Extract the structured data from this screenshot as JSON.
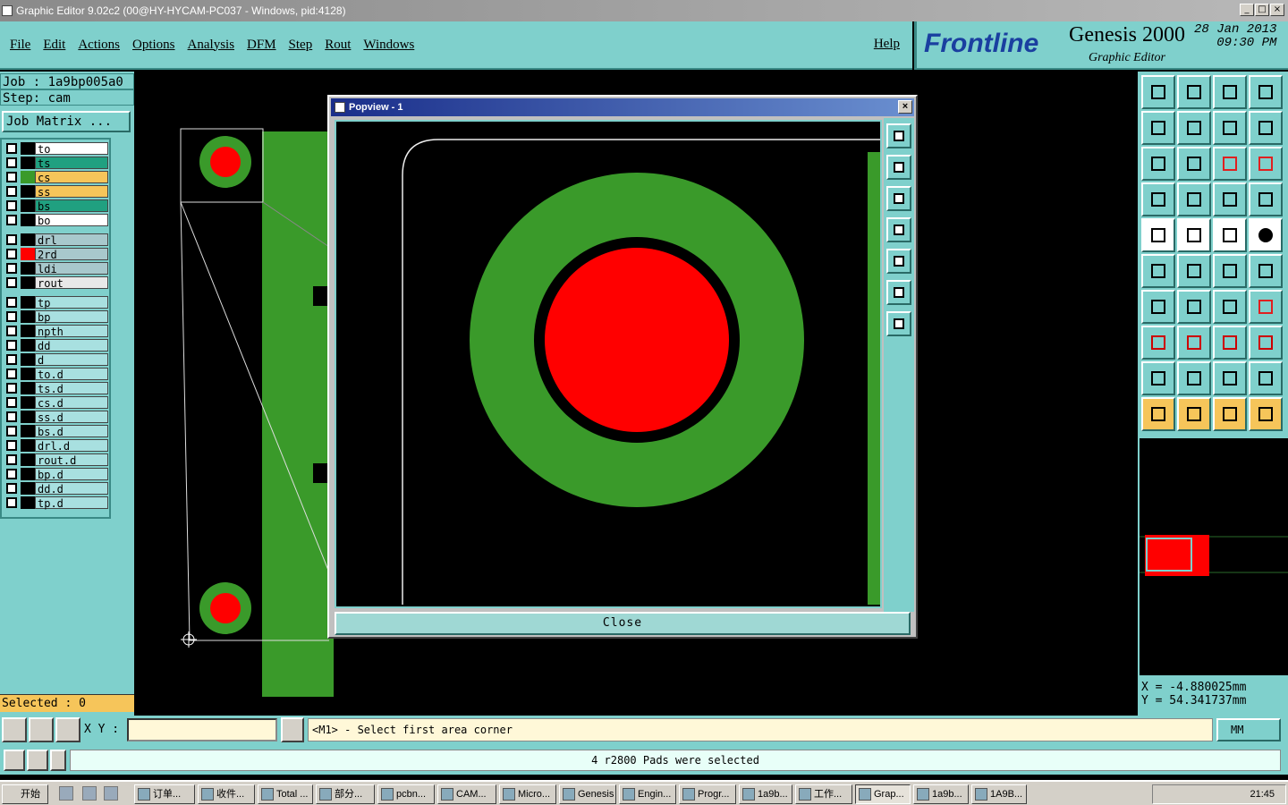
{
  "window": {
    "title": "Graphic Editor 9.02c2 (00@HY-HYCAM-PC037 - Windows, pid:4128)",
    "min": "_",
    "max": "□",
    "close": "×"
  },
  "menu": {
    "items": [
      "File",
      "Edit",
      "Actions",
      "Options",
      "Analysis",
      "DFM",
      "Step",
      "Rout",
      "Windows"
    ],
    "help": "Help"
  },
  "brand": {
    "logo": "Frontline",
    "product": "Genesis 2000",
    "subtitle": "Graphic Editor",
    "date": "28 Jan 2013",
    "time": "09:30 PM"
  },
  "job": {
    "job_line": "Job : 1a9bp005a0",
    "step_line": "Step: cam",
    "matrix_button": "Job Matrix ..."
  },
  "layers": [
    {
      "name": "to",
      "color": "#ffffff",
      "swatch": "#000000"
    },
    {
      "name": "ts",
      "color": "#20a080",
      "swatch": "#000000"
    },
    {
      "name": "cs",
      "color": "#f6c55a",
      "swatch": "#3a9a2a"
    },
    {
      "name": "ss",
      "color": "#f6c55a",
      "swatch": "#000000"
    },
    {
      "name": "bs",
      "color": "#20a080",
      "swatch": "#000000"
    },
    {
      "name": "bo",
      "color": "#ffffff",
      "swatch": "#000000"
    },
    {
      "name": "drl",
      "color": "#a8c8cc",
      "swatch": "#000000"
    },
    {
      "name": "2rd",
      "color": "#a8c8cc",
      "swatch": "#ff0000"
    },
    {
      "name": "ldi",
      "color": "#a8c8cc",
      "swatch": "#000000"
    },
    {
      "name": "rout",
      "color": "#e8e8e8",
      "swatch": "#000000"
    },
    {
      "name": "tp",
      "color": "#a8e0e0",
      "swatch": "#000000"
    },
    {
      "name": "bp",
      "color": "#a8e0e0",
      "swatch": "#000000"
    },
    {
      "name": "npth",
      "color": "#a8e0e0",
      "swatch": "#000000"
    },
    {
      "name": "dd",
      "color": "#a8e0e0",
      "swatch": "#000000"
    },
    {
      "name": "d",
      "color": "#a8e0e0",
      "swatch": "#000000"
    },
    {
      "name": "to.d",
      "color": "#a8e0e0",
      "swatch": "#000000"
    },
    {
      "name": "ts.d",
      "color": "#a8e0e0",
      "swatch": "#000000"
    },
    {
      "name": "cs.d",
      "color": "#a8e0e0",
      "swatch": "#000000"
    },
    {
      "name": "ss.d",
      "color": "#a8e0e0",
      "swatch": "#000000"
    },
    {
      "name": "bs.d",
      "color": "#a8e0e0",
      "swatch": "#000000"
    },
    {
      "name": "drl.d",
      "color": "#a8e0e0",
      "swatch": "#000000"
    },
    {
      "name": "rout.d",
      "color": "#a8e0e0",
      "swatch": "#000000"
    },
    {
      "name": "bp.d",
      "color": "#a8e0e0",
      "swatch": "#000000"
    },
    {
      "name": "dd.d",
      "color": "#a8e0e0",
      "swatch": "#000000"
    },
    {
      "name": "tp.d",
      "color": "#a8e0e0",
      "swatch": "#000000"
    }
  ],
  "selected_count": "Selected : 0",
  "popview": {
    "title": "Popview - 1",
    "close_label": "Close"
  },
  "coords": {
    "x": "X = -4.880025mm",
    "y": "Y = 54.341737mm"
  },
  "command": {
    "xy_label": "X Y :",
    "xy_value": "",
    "prompt": "<M1> - Select first area corner",
    "unit": "MM"
  },
  "status_message": "4 r2800 Pads were selected",
  "taskbar": {
    "start": "开始",
    "tasks": [
      "订单...",
      "收件...",
      "Total ...",
      "部分...",
      "pcbn...",
      "CAM...",
      "Micro...",
      "Genesis",
      "Engin...",
      "Progr...",
      "1a9b...",
      "工作...",
      "Grap...",
      "1a9b...",
      "1A9B..."
    ],
    "clock": "21:45"
  },
  "colors": {
    "panel": "#7fd0cc",
    "copper": "#3a9a2a",
    "pad": "#ff0000",
    "selected_bg": "#f6c55a"
  }
}
